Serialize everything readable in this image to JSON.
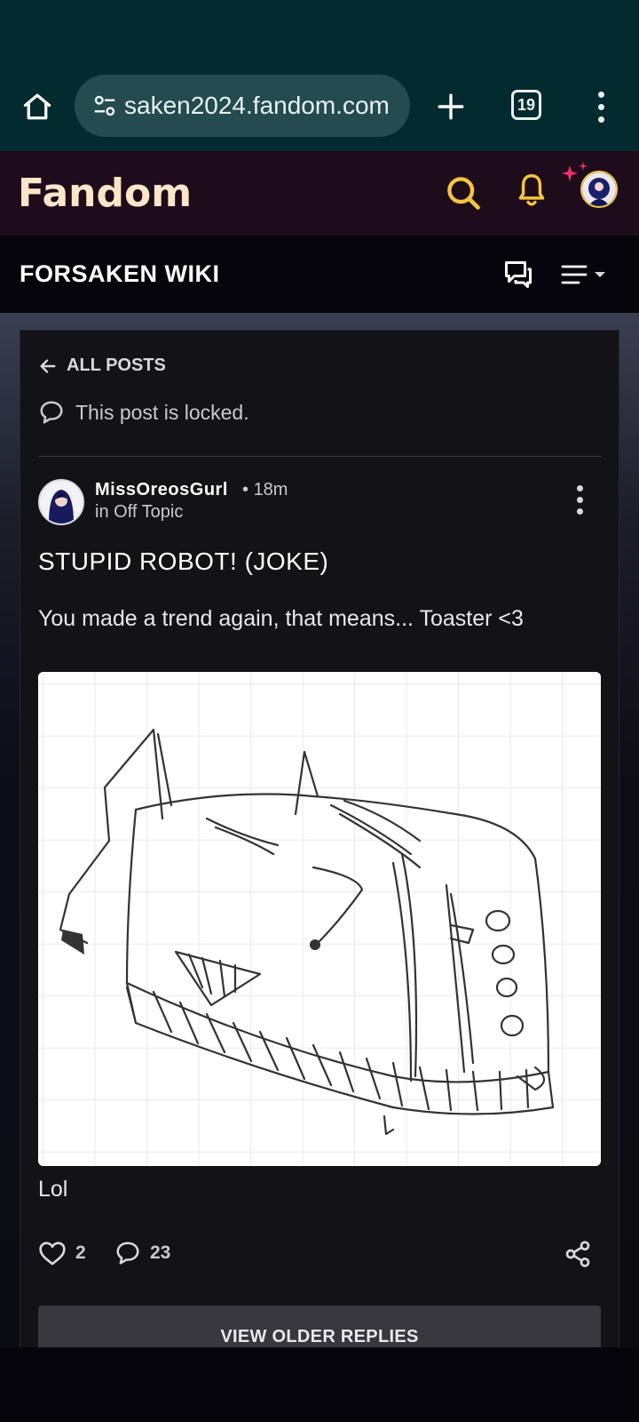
{
  "browser": {
    "url": "saken2024.fandom.com",
    "tab_count": "19"
  },
  "fandom": {
    "logo_text": "Fandom"
  },
  "wiki": {
    "title": "FORSAKEN WIKI"
  },
  "post": {
    "back_label": "ALL POSTS",
    "locked_text": "This post is locked.",
    "author": "MissOreosGurl",
    "time": "18m",
    "category": "in Off Topic",
    "title": "STUPID ROBOT! (JOKE)",
    "body": "You made a trend again, that means... Toaster <3",
    "caption": "Lol",
    "likes": "2",
    "comments": "23",
    "view_older_label": "VIEW OLDER REPLIES"
  },
  "colors": {
    "browser_bg": "#032a2e",
    "fandom_bar": "#1e0c1b",
    "accent_yellow": "#f5c542",
    "accent_pink": "#ff2d6a",
    "card_bg": "#121217"
  },
  "icons": [
    "home-icon",
    "tune-icon",
    "plus-icon",
    "tabs-icon",
    "overflow-menu-icon",
    "search-icon",
    "bell-icon",
    "sparkle-icon",
    "discussions-icon",
    "hamburger-menu-icon",
    "arrow-left-icon",
    "speech-bubble-icon",
    "heart-icon",
    "comment-icon",
    "share-icon"
  ]
}
